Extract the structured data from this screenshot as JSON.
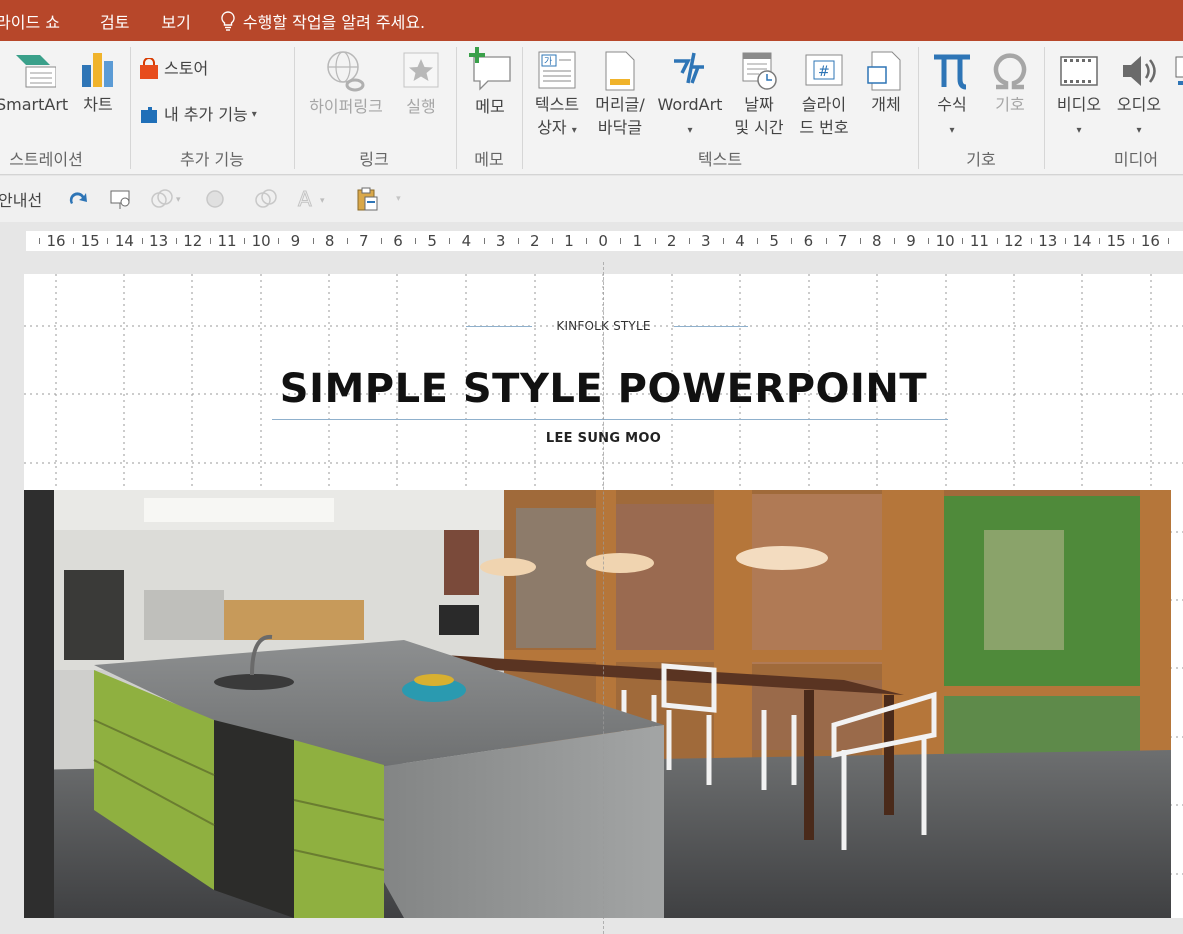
{
  "tabs": [
    {
      "label": "라이드 쇼"
    },
    {
      "label": "검토"
    },
    {
      "label": "보기"
    }
  ],
  "tell_me": {
    "text": "수행할 작업을 알려 주세요."
  },
  "ribbon": {
    "groups": {
      "illustrations": {
        "label": "스트레이션",
        "smartart": "SmartArt",
        "chart": "차트"
      },
      "addins": {
        "label": "추가 기능",
        "store": "스토어",
        "my_addins": "내 추가 기능"
      },
      "links": {
        "label": "링크",
        "hyperlink": "하이퍼링크",
        "action": "실행"
      },
      "comments": {
        "label": "메모",
        "comment": "메모"
      },
      "text": {
        "label": "텍스트",
        "textbox_1": "텍스트",
        "textbox_2": "상자",
        "header_1": "머리글/",
        "header_2": "바닥글",
        "wordart": "WordArt",
        "datetime_1": "날짜",
        "datetime_2": "및 시간",
        "slidenum_1": "슬라이",
        "slidenum_2": "드 번호",
        "object": "개체"
      },
      "symbols": {
        "label": "기호",
        "equation": "수식",
        "symbol": "기호"
      },
      "media": {
        "label": "미디어",
        "video": "비디오",
        "audio": "오디오"
      }
    }
  },
  "qat": {
    "label": "안내선"
  },
  "ruler": {
    "labels": [
      "16",
      "15",
      "14",
      "13",
      "12",
      "11",
      "10",
      "9",
      "8",
      "7",
      "6",
      "5",
      "4",
      "3",
      "2",
      "1",
      "0",
      "1",
      "2",
      "3",
      "4",
      "5",
      "6",
      "7",
      "8",
      "9",
      "10",
      "11",
      "12",
      "13",
      "14",
      "15",
      "16"
    ]
  },
  "slide": {
    "kicker": "KINFOLK STYLE",
    "title": "SIMPLE STYLE POWERPOINT",
    "author": "LEE SUNG MOO"
  },
  "colors": {
    "accent": "#b7472a",
    "pi_blue": "#2e75b6",
    "title_line": "#8fb0cc"
  }
}
